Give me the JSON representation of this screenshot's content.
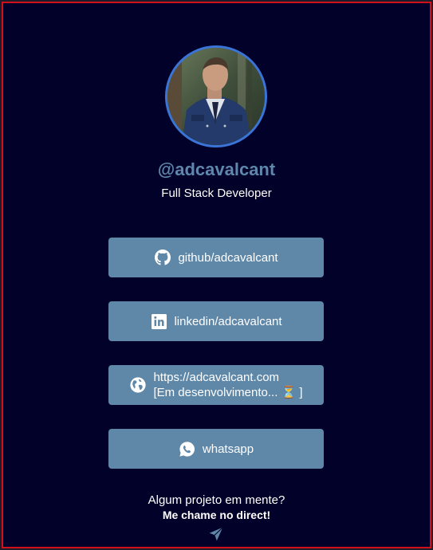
{
  "profile": {
    "handle": "@adcavalcant",
    "role": "Full Stack Developer",
    "avatar_alt": "profile-photo"
  },
  "links": [
    {
      "label": "github/adcavalcant",
      "icon": "github-icon"
    },
    {
      "label": "linkedin/adcavalcant",
      "icon": "linkedin-icon"
    },
    {
      "label_line1": "https://adcavalcant.com",
      "label_line2": "[Em desenvolvimento... ⏳ ]",
      "icon": "globe-icon"
    },
    {
      "label": "whatsapp",
      "icon": "whatsapp-icon"
    }
  ],
  "cta": {
    "question": "Algum projeto em mente?",
    "action": "Me chame no direct!",
    "icon": "send-icon"
  },
  "colors": {
    "background": "#01012a",
    "border": "#d0101a",
    "button": "#5f87a8",
    "handle": "#5f87ab",
    "avatar_ring": "#3b74d8"
  }
}
